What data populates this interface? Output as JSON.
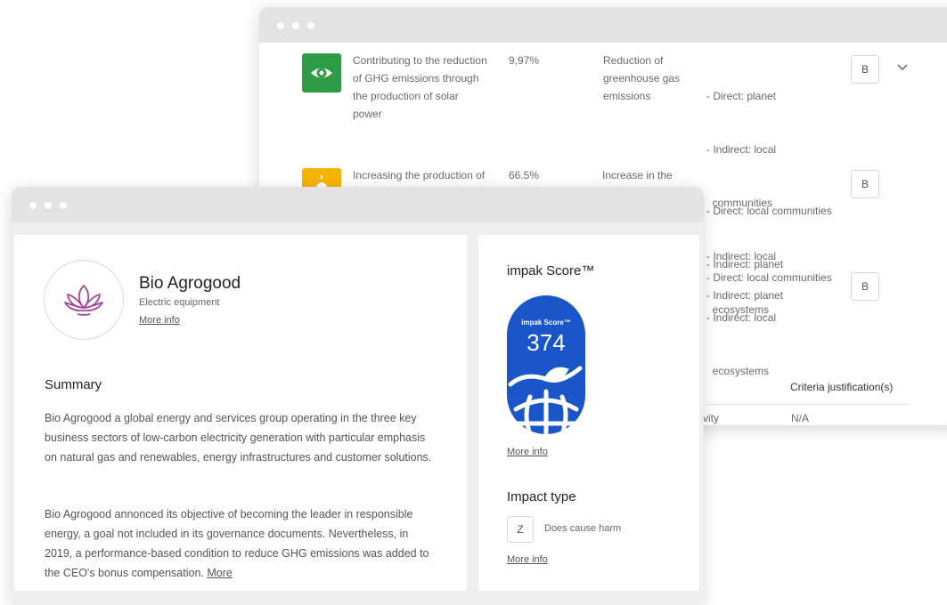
{
  "back_window": {
    "rows": [
      {
        "description": [
          "Contributing to the reduction",
          "of GHG emissions through",
          "the production of solar",
          "power"
        ],
        "percent": "9,97%",
        "outcome": [
          "Reduction of",
          "greenhouse gas",
          "emissions"
        ],
        "stakeholders": [
          "- Direct: planet",
          "- Indirect: local",
          "  communities",
          "- Indirect: local",
          "  ecosystems"
        ],
        "grade": "B",
        "icon": "eye-icon",
        "icon_color": "#2e9b47"
      },
      {
        "description": [
          "Increasing the production of"
        ],
        "percent": "66.5%",
        "outcome": [
          "Increase in the"
        ],
        "stakeholders": [
          "- Direct: local communities",
          "- Indirect: planet",
          "- Indirect: local",
          "  ecosystems"
        ],
        "grade": "B",
        "icon": "sun-icon",
        "icon_color": "#f5b400"
      },
      {
        "stakeholders": [
          "- Direct: local communities",
          "- Indirect: planet"
        ],
        "grade": "B"
      }
    ],
    "table_header": "Criteria justification(s)",
    "table_row_partial": "vity",
    "table_row_value": "N/A"
  },
  "company": {
    "name": "Bio Agrogood",
    "sector": "Electric equipment",
    "more_info": "More info",
    "logo_icon": "lotus-icon",
    "logo_color": "#a4469a"
  },
  "summary": {
    "heading": "Summary",
    "paragraph1": "Bio Agrogood a global energy and services group operating in the three key business sectors of low-carbon electricity generation with particular emphasis on natural gas and renewables, energy infrastructures and customer solutions.",
    "paragraph2": "Bio Agrogood annonced its objective of becoming the leader in responsible energy, a goal not included in its governance documents. Nevertheless, in 2019, a performance-based condition to reduce GHG emissions was added to the CEO's bonus compensation.",
    "more": "More"
  },
  "score": {
    "heading": "impak Score™",
    "badge_label": "impak Score™",
    "value": "374",
    "badge_color": "#1a56c8",
    "more_info": "More info"
  },
  "impact_type": {
    "heading": "Impact type",
    "code": "Z",
    "label": "Does cause harm",
    "more_info": "More info"
  }
}
